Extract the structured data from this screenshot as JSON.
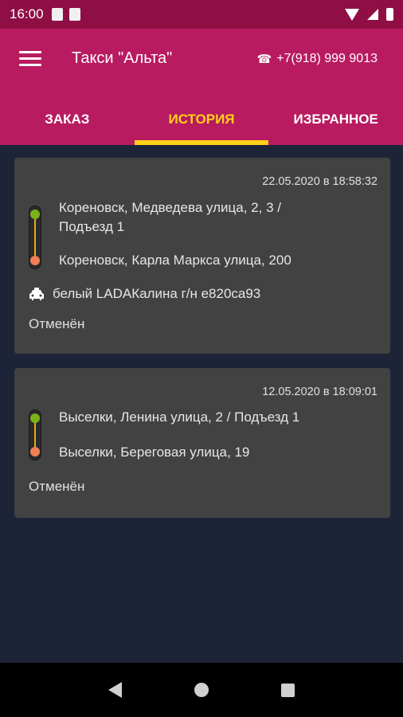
{
  "status_bar": {
    "time": "16:00"
  },
  "app": {
    "title": "Такси \"Альта\"",
    "phone": "+7(918) 999 9013"
  },
  "tabs": [
    {
      "label": "ЗАКАЗ",
      "active": false
    },
    {
      "label": "ИСТОРИЯ",
      "active": true
    },
    {
      "label": "ИЗБРАННОЕ",
      "active": false
    }
  ],
  "orders": [
    {
      "datetime": "22.05.2020 в 18:58:32",
      "from_line1": "Кореновск, Медведева улица, 2, 3 /",
      "from_line2": "Подъезд 1",
      "to": "Кореновск, Карла Маркса улица, 200",
      "car": "белый LADAКалина г/н е820са93",
      "status": "Отменён"
    },
    {
      "datetime": "12.05.2020 в 18:09:01",
      "from_line1": "Выселки, Ленина улица, 2 / Подъезд 1",
      "to": "Выселки, Береговая улица, 19",
      "status": "Отменён"
    }
  ],
  "colors": {
    "app_bar": "#b81b60",
    "status_bar": "#8f0f45",
    "active_tab": "#ffd11a",
    "background": "#1e2438",
    "card": "#424242",
    "start_dot": "#7ab317",
    "end_dot": "#f07f54"
  }
}
